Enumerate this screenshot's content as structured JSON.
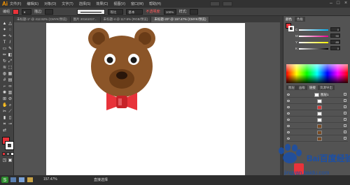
{
  "app": {
    "logo": "Ai",
    "menus": [
      "文件(F)",
      "编辑(E)",
      "对象(O)",
      "文字(T)",
      "选择(S)",
      "效果(C)",
      "视图(V)",
      "窗口(W)",
      "帮助(H)"
    ]
  },
  "control_bar": {
    "selection_label": "编组",
    "stroke_label": "描边:",
    "stroke_style": "等比",
    "basic_label": "基本",
    "opacity_label": "不透明度:",
    "opacity_value": "100%",
    "style_label": "样式:",
    "fill_color": "#e8333a"
  },
  "tabs": [
    {
      "label": "未标题-1* @ 412.92% (CMYK/预览)",
      "active": false
    },
    {
      "label": "图片 20161017...",
      "active": false
    },
    {
      "label": "未标题-4 @ 117.6% (RGB/预览)",
      "active": false
    },
    {
      "label": "未标题-20* @ 157.47% (CMYK/预览)",
      "active": true
    }
  ],
  "color_panel": {
    "channels": [
      {
        "label": "C",
        "value": "0",
        "colors": [
          "#ffffff",
          "#00aeef"
        ]
      },
      {
        "label": "M",
        "value": "90",
        "colors": [
          "#ffffff",
          "#ec008c"
        ]
      },
      {
        "label": "Y",
        "value": "85",
        "colors": [
          "#ffffff",
          "#fff200"
        ]
      },
      {
        "label": "K",
        "value": "0",
        "colors": [
          "#ffffff",
          "#000000"
        ]
      }
    ]
  },
  "layers_panel": {
    "tabs": [
      "图层",
      "画板",
      "链接",
      "资源导出"
    ],
    "layers": [
      {
        "name": "图层1",
        "highlighted": false
      },
      {
        "name": "",
        "highlighted": false
      },
      {
        "name": "",
        "highlighted": false
      },
      {
        "name": "",
        "highlighted": false
      },
      {
        "name": "",
        "highlighted": false
      },
      {
        "name": "",
        "highlighted": false
      },
      {
        "name": "",
        "highlighted": false
      },
      {
        "name": "",
        "highlighted": false
      }
    ]
  },
  "status": {
    "zoom": "157.47%",
    "tool": "直接选择"
  },
  "watermark": {
    "brand": "Bai百度经验",
    "url": "jingyan.baidu.com"
  },
  "illustration": {
    "bear_brown": "#8b5528",
    "ear_inner": "#6a3c17",
    "bow_red": "#e8333a",
    "bow_knot": "#c62228"
  }
}
